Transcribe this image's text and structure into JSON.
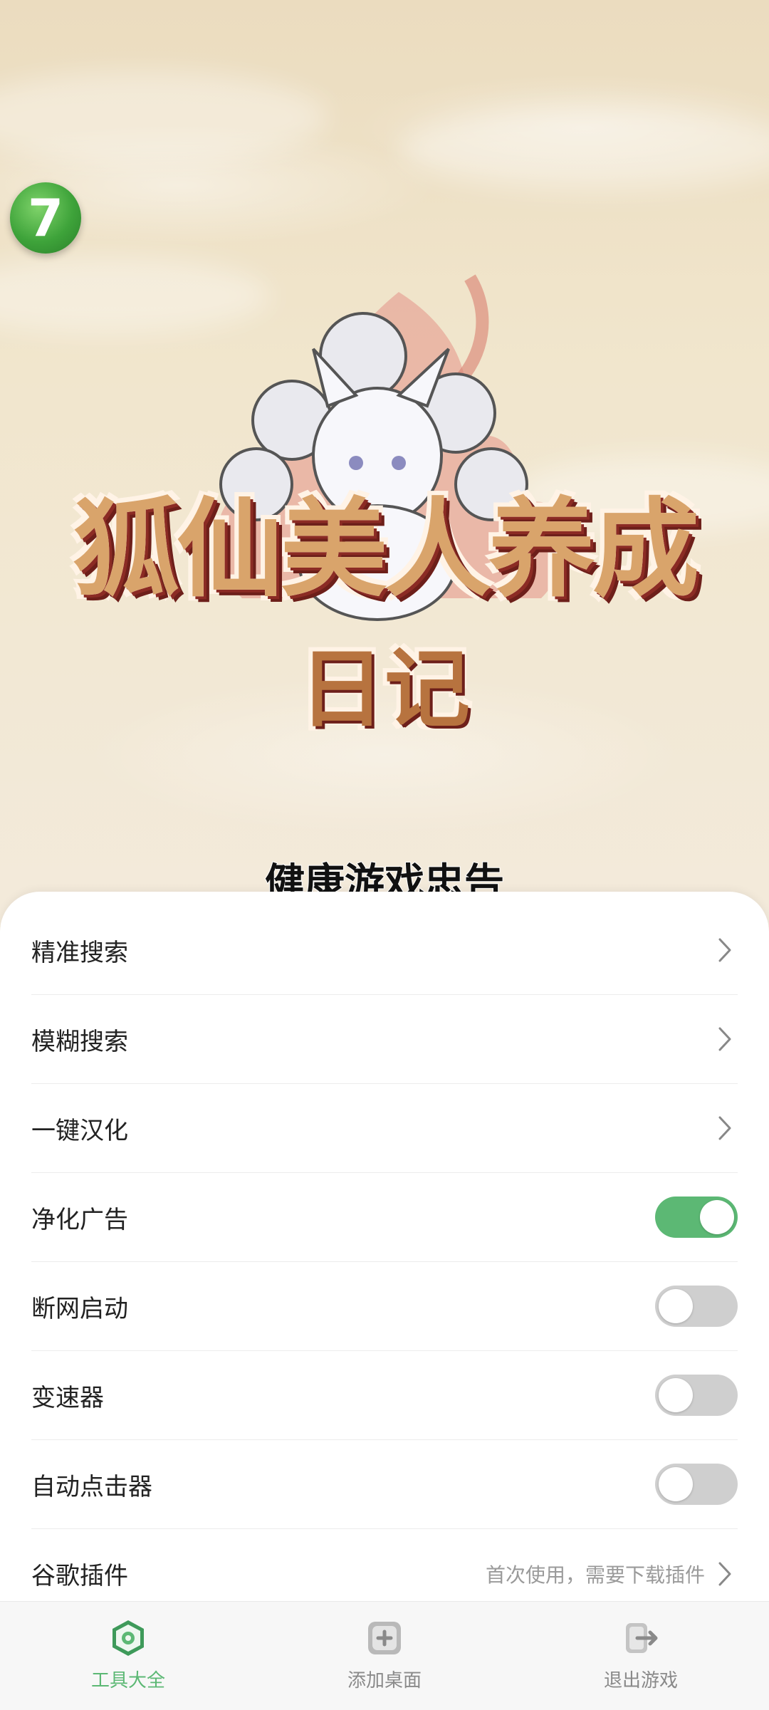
{
  "splash": {
    "title_line1": "狐仙美人养成",
    "title_line2": "日记",
    "health_notice": "健康游戏忠告",
    "float_badge": "7"
  },
  "menu": {
    "rows": [
      {
        "label": "精准搜索",
        "control": "chevron"
      },
      {
        "label": "模糊搜索",
        "control": "chevron"
      },
      {
        "label": "一键汉化",
        "control": "chevron"
      },
      {
        "label": "净化广告",
        "control": "toggle",
        "on": true
      },
      {
        "label": "断网启动",
        "control": "toggle",
        "on": false
      },
      {
        "label": "变速器",
        "control": "toggle",
        "on": false
      },
      {
        "label": "自动点击器",
        "control": "toggle",
        "on": false
      },
      {
        "label": "谷歌插件",
        "control": "chevron",
        "hint": "首次使用，需要下载插件"
      }
    ]
  },
  "tabbar": {
    "tabs": [
      {
        "label": "工具大全",
        "icon": "tools-icon",
        "active": true
      },
      {
        "label": "添加桌面",
        "icon": "add-desktop-icon",
        "active": false
      },
      {
        "label": "退出游戏",
        "icon": "exit-icon",
        "active": false
      }
    ]
  },
  "colors": {
    "accent": "#5cb874",
    "toggle_off": "#cfcfcf",
    "background": "#efe4c9"
  }
}
